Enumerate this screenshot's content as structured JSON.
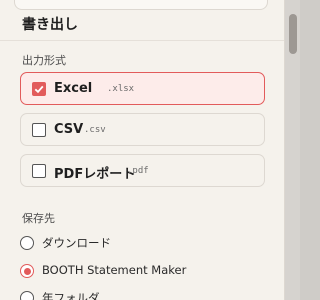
{
  "colors": {
    "accent": "#e25b5b",
    "panel_bg": "#f5f2ec",
    "selected_bg": "#fdecea"
  },
  "export": {
    "title": "書き出し",
    "format_group_label": "出力形式",
    "formats": [
      {
        "label": "Excel",
        "ext": ".xlsx",
        "checked": true
      },
      {
        "label": "CSV",
        "ext": ".csv",
        "checked": false
      },
      {
        "label": "PDFレポート",
        "ext": ".pdf",
        "checked": false
      }
    ],
    "destination_group_label": "保存先",
    "destinations": [
      {
        "label": "ダウンロード",
        "selected": false
      },
      {
        "label": "BOOTH Statement Maker",
        "selected": true
      },
      {
        "label": "年フォルダ",
        "selected": false
      }
    ]
  }
}
